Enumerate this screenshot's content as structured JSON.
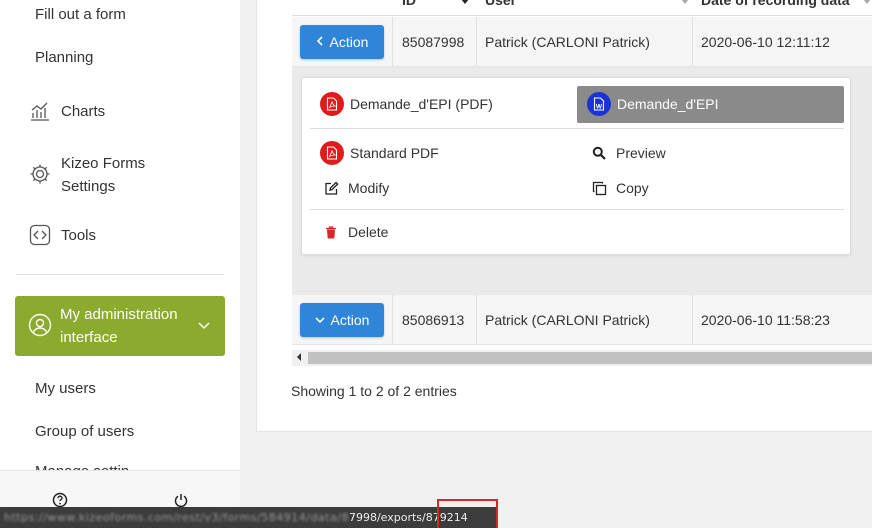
{
  "sidebar": {
    "items": {
      "fill_form": "Fill out a form",
      "planning": "Planning",
      "charts": "Charts",
      "settings_line1": "Kizeo Forms",
      "settings_line2": "Settings",
      "tools": "Tools",
      "admin_line1": "My administration",
      "admin_line2": "interface",
      "my_users": "My users",
      "group_of_users": "Group of users",
      "truncated": "Manage settin"
    },
    "accent_color": "#8bab2f"
  },
  "table": {
    "headers": {
      "id": "ID",
      "user": "User",
      "date": "Date of recording data"
    },
    "rows": [
      {
        "action": "Action",
        "id": "85087998",
        "user": "Patrick (CARLONI Patrick)",
        "date": "2020-06-10 12:11:12"
      },
      {
        "action": "Action",
        "id": "85086913",
        "user": "Patrick (CARLONI Patrick)",
        "date": "2020-06-10 11:58:23"
      }
    ],
    "showing": "Showing 1 to 2 of 2 entries"
  },
  "action_menu": {
    "pdf_label": "Demande_d'EPI (PDF)",
    "word_label": "Demande_d'EPI",
    "standard_pdf": "Standard PDF",
    "preview": "Preview",
    "modify": "Modify",
    "copy": "Copy",
    "delete": "Delete"
  },
  "statusbar": {
    "blurred_url": "https://www.kizeoforms.com/rest/v3/forms/584914/data/8",
    "url_tail": "7998/exports/",
    "export_id": "879214"
  },
  "colors": {
    "primary_button": "#2f86d8",
    "pdf_icon": "#e01b1b",
    "word_icon": "#1a33d6",
    "delete_icon": "#d9262c"
  }
}
